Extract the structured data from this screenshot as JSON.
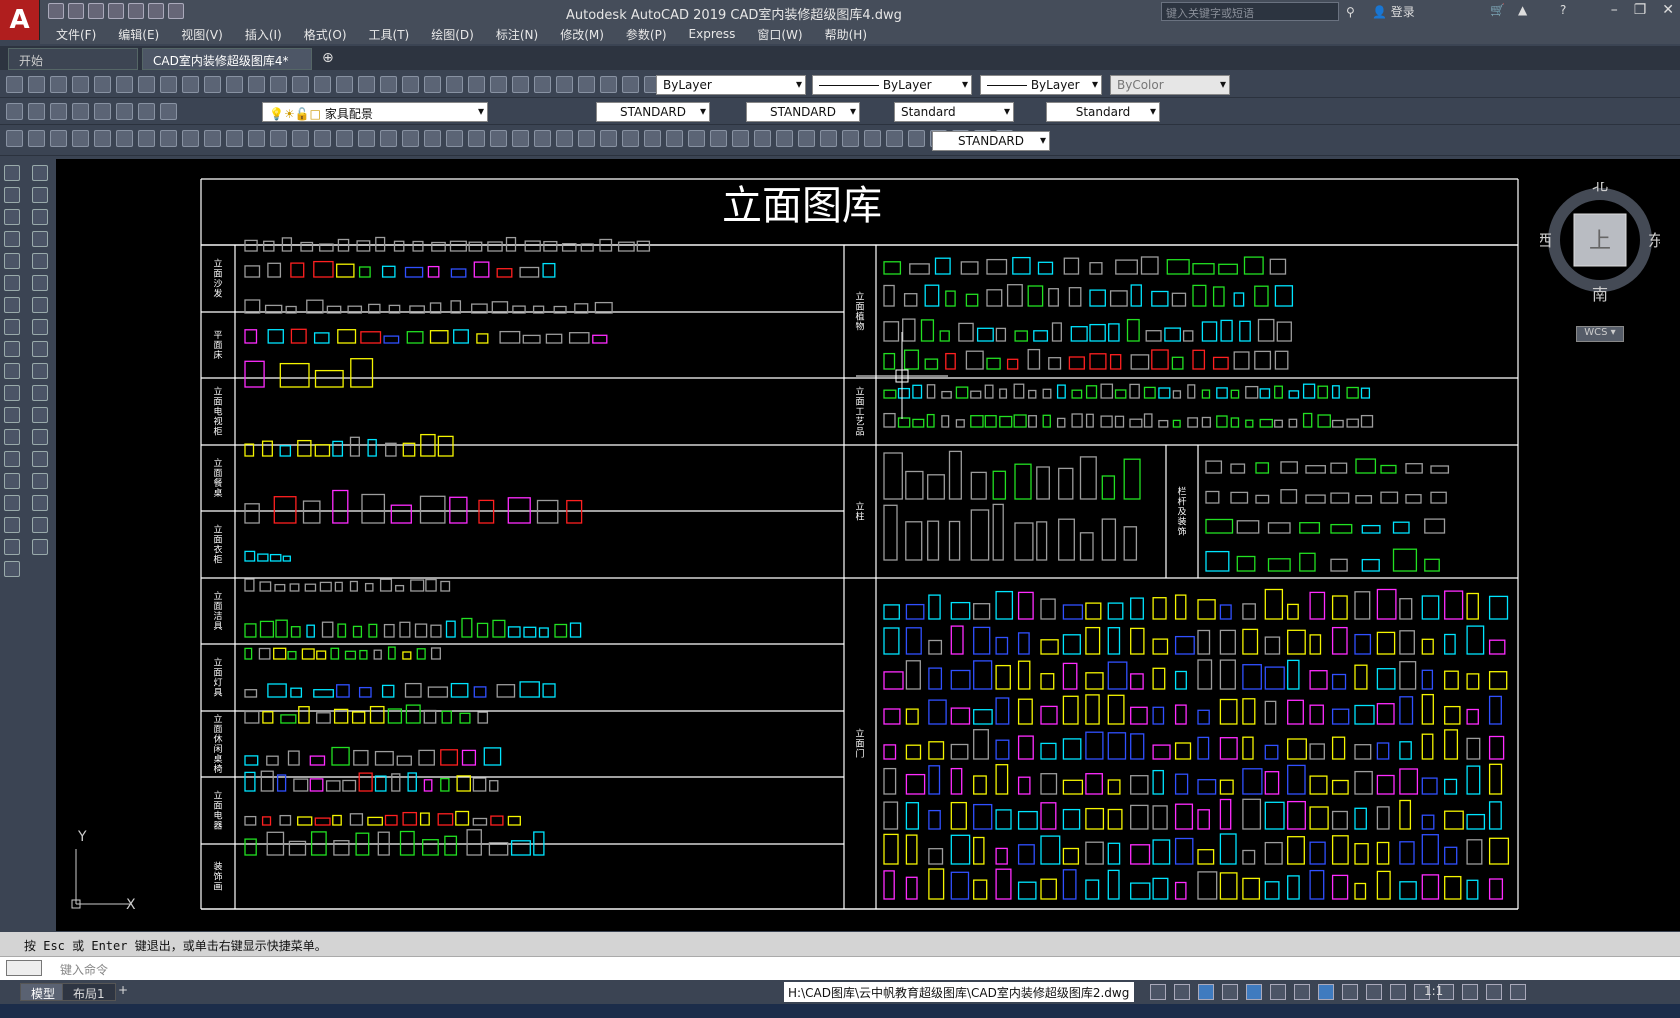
{
  "app": {
    "title": "Autodesk AutoCAD 2019    CAD室内装修超级图库4.dwg",
    "logo_letter": "A",
    "search_placeholder": "键入关键字或短语",
    "login_label": "登录"
  },
  "menu": [
    "文件(F)",
    "编辑(E)",
    "视图(V)",
    "插入(I)",
    "格式(O)",
    "工具(T)",
    "绘图(D)",
    "标注(N)",
    "修改(M)",
    "参数(P)",
    "Express",
    "窗口(W)",
    "帮助(H)"
  ],
  "tabs": [
    {
      "label": "开始"
    },
    {
      "label": "CAD室内装修超级图库4*"
    }
  ],
  "properties": {
    "color": "ByLayer",
    "linetype": "ByLayer",
    "lineweight": "ByLayer",
    "plotstyle": "ByColor"
  },
  "layer": {
    "current": "家具配景"
  },
  "styles": {
    "text_style": "STANDARD",
    "dim_style": "STANDARD",
    "table_style": "Standard",
    "mleader_style": "Standard",
    "visual_style": "STANDARD"
  },
  "drawing": {
    "title": "立面图库",
    "left_sections": [
      "立面沙发",
      "平面床",
      "立面电视柜",
      "立面餐桌",
      "立面衣柜",
      "立面洁具",
      "立面灯具",
      "立面休闲桌椅",
      "立面电器",
      "装饰画"
    ],
    "right_sections": [
      "立面植物",
      "立面工艺品",
      "立柱",
      "栏杆及装饰",
      "立面门"
    ]
  },
  "viewcube": {
    "north": "北",
    "south": "南",
    "east": "东",
    "west": "西",
    "face": "上",
    "ucs": "WCS"
  },
  "ucs_icon": {
    "x_label": "X",
    "y_label": "Y"
  },
  "command": {
    "history": "按 Esc 或 Enter 键退出，或单击右键显示快捷菜单。",
    "placeholder": "键入命令"
  },
  "status": {
    "layout_tabs": [
      "模型",
      "布局1"
    ],
    "filepath": "H:\\CAD图库\\云中帆教育超级图库\\CAD室内装修超级图库2.dwg",
    "scale": "1:1"
  },
  "colors": {
    "canvas": "#000000",
    "frame": "#ffffff",
    "block_green": "#22e022",
    "block_yellow": "#f5f500",
    "block_magenta": "#ff2cff",
    "block_cyan": "#00e5ff",
    "block_grey": "#9c9c9c",
    "block_red": "#ff2020",
    "block_blue": "#3050ff"
  }
}
